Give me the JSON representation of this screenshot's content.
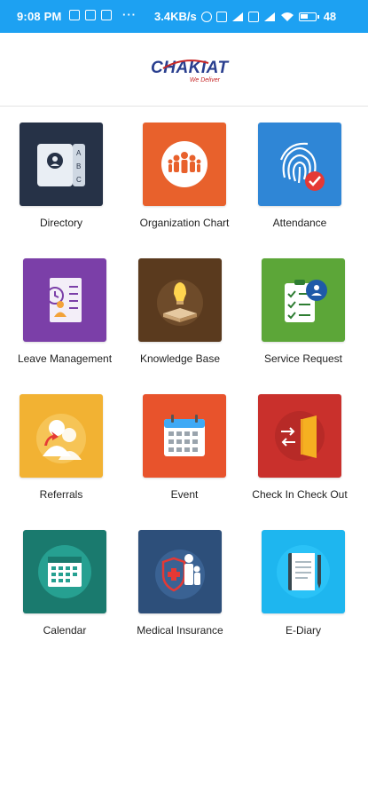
{
  "status_bar": {
    "time": "9:08 PM",
    "speed": "3.4KB/s",
    "battery": "48"
  },
  "app": {
    "logo_text": "CHAKIAT",
    "logo_tagline": "We Deliver"
  },
  "tiles": [
    {
      "label": "Directory",
      "icon": "directory-icon",
      "color": "#263247"
    },
    {
      "label": "Organization Chart",
      "icon": "organization-chart-icon",
      "color": "#e8612c"
    },
    {
      "label": "Attendance",
      "icon": "fingerprint-icon",
      "color": "#2f86d6"
    },
    {
      "label": "Leave Management",
      "icon": "leave-management-icon",
      "color": "#7b3fa8"
    },
    {
      "label": "Knowledge Base",
      "icon": "knowledge-base-icon",
      "color": "#5a3a1e"
    },
    {
      "label": "Service Request",
      "icon": "service-request-icon",
      "color": "#5ca638"
    },
    {
      "label": "Referrals",
      "icon": "referrals-icon",
      "color": "#f2b233"
    },
    {
      "label": "Event",
      "icon": "event-calendar-icon",
      "color": "#e8532c"
    },
    {
      "label": "Check In Check Out",
      "icon": "check-in-door-icon",
      "color": "#c9302c"
    },
    {
      "label": "Calendar",
      "icon": "calendar-icon",
      "color": "#1a7a6e"
    },
    {
      "label": "Medical Insurance",
      "icon": "medical-insurance-icon",
      "color": "#2d4f7a"
    },
    {
      "label": "E-Diary",
      "icon": "e-diary-icon",
      "color": "#1eb6ef"
    }
  ]
}
